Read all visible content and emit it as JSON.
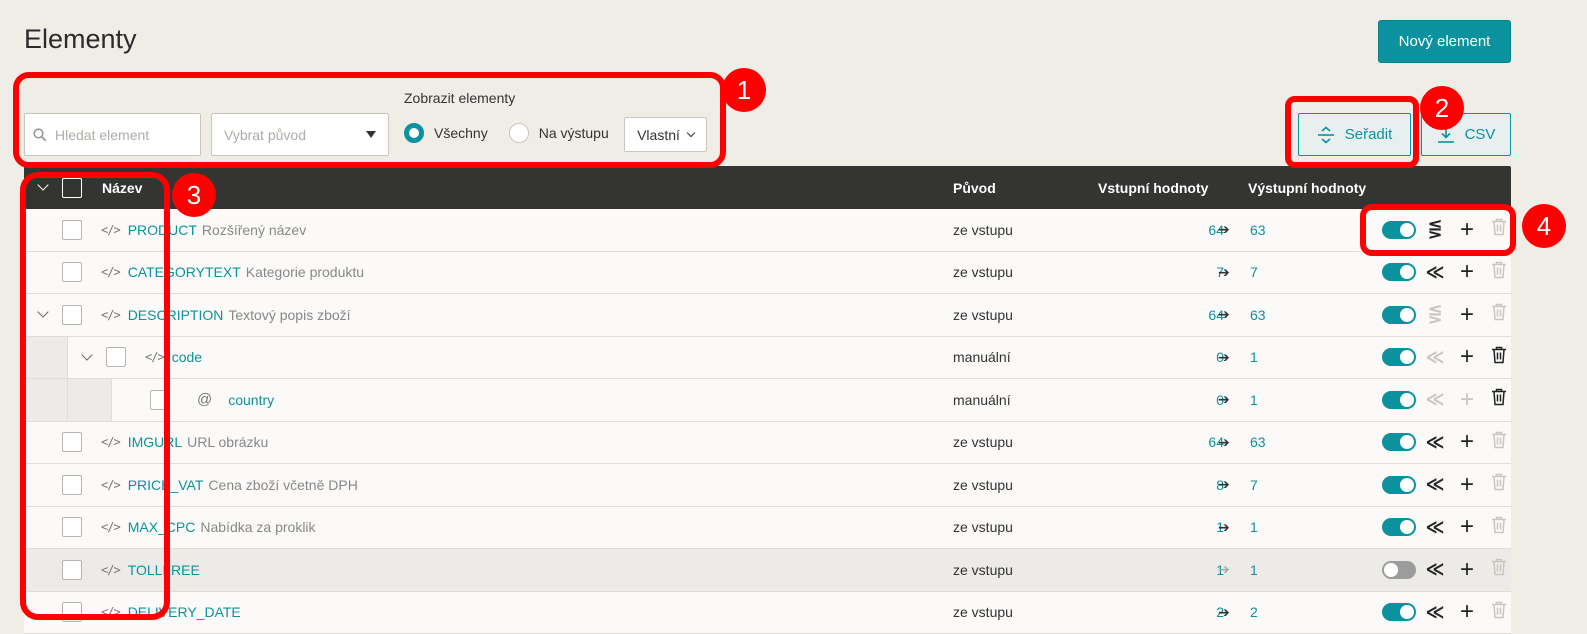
{
  "page": {
    "title": "Elementy",
    "new_button": "Nový element"
  },
  "filters": {
    "search_placeholder": "Hledat element",
    "origin_placeholder": "Vybrat původ",
    "show_label": "Zobrazit elementy",
    "radio_all": "Všechny",
    "radio_output": "Na výstupu",
    "custom_select": "Vlastní"
  },
  "toolbar": {
    "sort_label": "Seřadit",
    "csv_label": "CSV"
  },
  "table": {
    "headers": {
      "name": "Název",
      "origin": "Původ",
      "input": "Vstupní hodnoty",
      "output": "Výstupní hodnoty"
    },
    "rows": [
      {
        "name": "PRODUCT",
        "desc": "Rozšířený název",
        "origin": "ze vstupu",
        "in": "64",
        "out": "63",
        "level": 0,
        "type": "element",
        "expand": false,
        "enabled": true,
        "map": "active-crossed",
        "add": true,
        "del": false
      },
      {
        "name": "CATEGORYTEXT",
        "desc": "Kategorie produktu",
        "origin": "ze vstupu",
        "in": "7",
        "out": "7",
        "level": 0,
        "type": "element",
        "expand": false,
        "enabled": true,
        "map": "active",
        "add": true,
        "del": false
      },
      {
        "name": "DESCRIPTION",
        "desc": "Textový popis zboží",
        "origin": "ze vstupu",
        "in": "64",
        "out": "63",
        "level": 0,
        "type": "element",
        "expand": true,
        "enabled": true,
        "map": "dim-crossed",
        "add": true,
        "del": false
      },
      {
        "name": "code",
        "desc": "",
        "origin": "manuální",
        "in": "0",
        "out": "1",
        "level": 1,
        "type": "element",
        "expand": true,
        "enabled": true,
        "map": "dim",
        "add": true,
        "del": true
      },
      {
        "name": "country",
        "desc": "",
        "origin": "manuální",
        "in": "0",
        "out": "1",
        "level": 2,
        "type": "attribute",
        "expand": false,
        "enabled": true,
        "map": "dim",
        "add": false,
        "del": true
      },
      {
        "name": "IMGURL",
        "desc": "URL obrázku",
        "origin": "ze vstupu",
        "in": "64",
        "out": "63",
        "level": 0,
        "type": "element",
        "expand": false,
        "enabled": true,
        "map": "active",
        "add": true,
        "del": false
      },
      {
        "name": "PRICE_VAT",
        "desc": "Cena zboží včetně DPH",
        "origin": "ze vstupu",
        "in": "8",
        "out": "7",
        "level": 0,
        "type": "element",
        "expand": false,
        "enabled": true,
        "map": "active",
        "add": true,
        "del": false
      },
      {
        "name": "MAX_CPC",
        "desc": "Nabídka za proklik",
        "origin": "ze vstupu",
        "in": "1",
        "out": "1",
        "level": 0,
        "type": "element",
        "expand": false,
        "enabled": true,
        "map": "active",
        "add": true,
        "del": false
      },
      {
        "name": "TOLLFREE",
        "desc": "",
        "origin": "ze vstupu",
        "in": "1",
        "out": "1",
        "level": 0,
        "type": "element",
        "expand": false,
        "enabled": false,
        "map": "active",
        "add": true,
        "del": false
      },
      {
        "name": "DELIVERY_DATE",
        "desc": "",
        "origin": "ze vstupu",
        "in": "2",
        "out": "2",
        "level": 0,
        "type": "element",
        "expand": false,
        "enabled": true,
        "map": "active",
        "add": true,
        "del": false
      }
    ]
  },
  "annotations": {
    "badge1": "1",
    "badge2": "2",
    "badge3": "3",
    "badge4": "4"
  },
  "colors": {
    "accent": "#0b929e",
    "annotation": "#ff0000",
    "header_bg": "#343432",
    "page_bg": "#f0ede7"
  },
  "icons": {
    "search": "search-icon",
    "sort": "sort-icon",
    "download": "download-icon",
    "code": "code-icon",
    "attribute": "at-icon",
    "map": "mapping-icon",
    "add": "plus-icon",
    "delete": "trash-icon"
  }
}
